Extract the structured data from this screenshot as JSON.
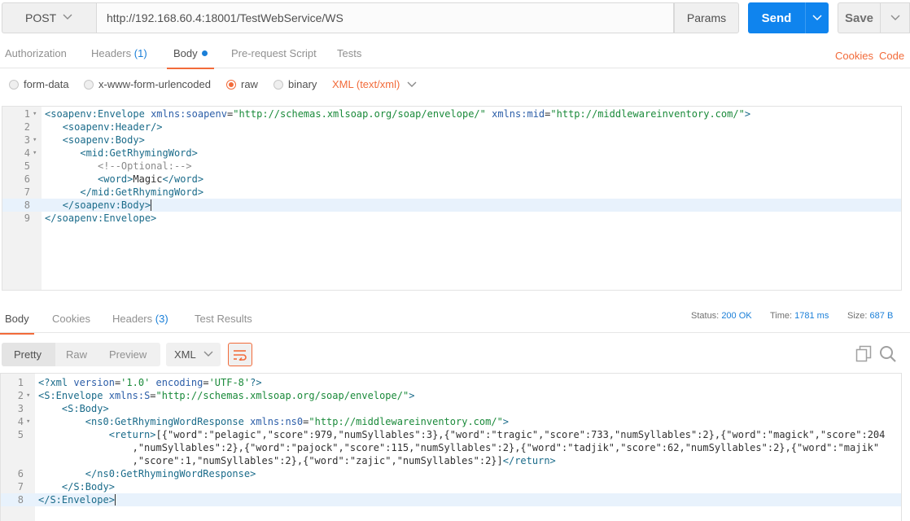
{
  "request": {
    "method": "POST",
    "url": "http://192.168.60.4:18001/TestWebService/WS",
    "params_label": "Params",
    "send_label": "Send",
    "save_label": "Save"
  },
  "request_tabs": [
    {
      "label": "Authorization"
    },
    {
      "label": "Headers",
      "count": "(1)"
    },
    {
      "label": "Body"
    },
    {
      "label": "Pre-request Script"
    },
    {
      "label": "Tests"
    }
  ],
  "links": {
    "cookies": "Cookies",
    "code": "Code"
  },
  "body_types": [
    "form-data",
    "x-www-form-urlencoded",
    "raw",
    "binary"
  ],
  "content_type": "XML (text/xml)",
  "request_body": {
    "line_numbers": [
      "1",
      "2",
      "3",
      "4",
      "5",
      "6",
      "7",
      "8",
      "9"
    ],
    "lines": [
      "<soapenv:Envelope xmlns:soapenv=\"http://schemas.xmlsoap.org/soap/envelope/\" xmlns:mid=\"http://middlewareinventory.com/\">",
      "   <soapenv:Header/>",
      "   <soapenv:Body>",
      "      <mid:GetRhymingWord>",
      "         <!--Optional:-->",
      "         <word>Magic</word>",
      "      </mid:GetRhymingWord>",
      "   </soapenv:Body>",
      "</soapenv:Envelope>"
    ]
  },
  "response_tabs": [
    {
      "label": "Body"
    },
    {
      "label": "Cookies"
    },
    {
      "label": "Headers",
      "count": "(3)"
    },
    {
      "label": "Test Results"
    }
  ],
  "response_status": {
    "status_label": "Status:",
    "status_value": "200 OK",
    "time_label": "Time:",
    "time_value": "1781 ms",
    "size_label": "Size:",
    "size_value": "687 B"
  },
  "view_modes": [
    "Pretty",
    "Raw",
    "Preview"
  ],
  "response_format": "XML",
  "response_body": {
    "line_numbers": [
      "1",
      "2",
      "3",
      "4",
      "5",
      "",
      "",
      "6",
      "7",
      "8"
    ],
    "lines": [
      "<?xml version='1.0' encoding='UTF-8'?>",
      "<S:Envelope xmlns:S=\"http://schemas.xmlsoap.org/soap/envelope/\">",
      "    <S:Body>",
      "        <ns0:GetRhymingWordResponse xmlns:ns0=\"http://middlewareinventory.com/\">",
      "            <return>[{\"word\":\"pelagic\",\"score\":979,\"numSyllables\":3},{\"word\":\"tragic\",\"score\":733,\"numSyllables\":2},{\"word\":\"magick\",\"score\":204",
      "                ,\"numSyllables\":2},{\"word\":\"pajock\",\"score\":115,\"numSyllables\":2},{\"word\":\"tadjik\",\"score\":62,\"numSyllables\":2},{\"word\":\"majik\"",
      "                ,\"score\":1,\"numSyllables\":2},{\"word\":\"zajic\",\"numSyllables\":2}]</return>",
      "        </ns0:GetRhymingWordResponse>",
      "    </S:Body>",
      "</S:Envelope>"
    ]
  },
  "colors": {
    "accent_orange": "#f26b3a",
    "send_blue": "#0f84ee",
    "link_blue": "#1a7fd8"
  }
}
